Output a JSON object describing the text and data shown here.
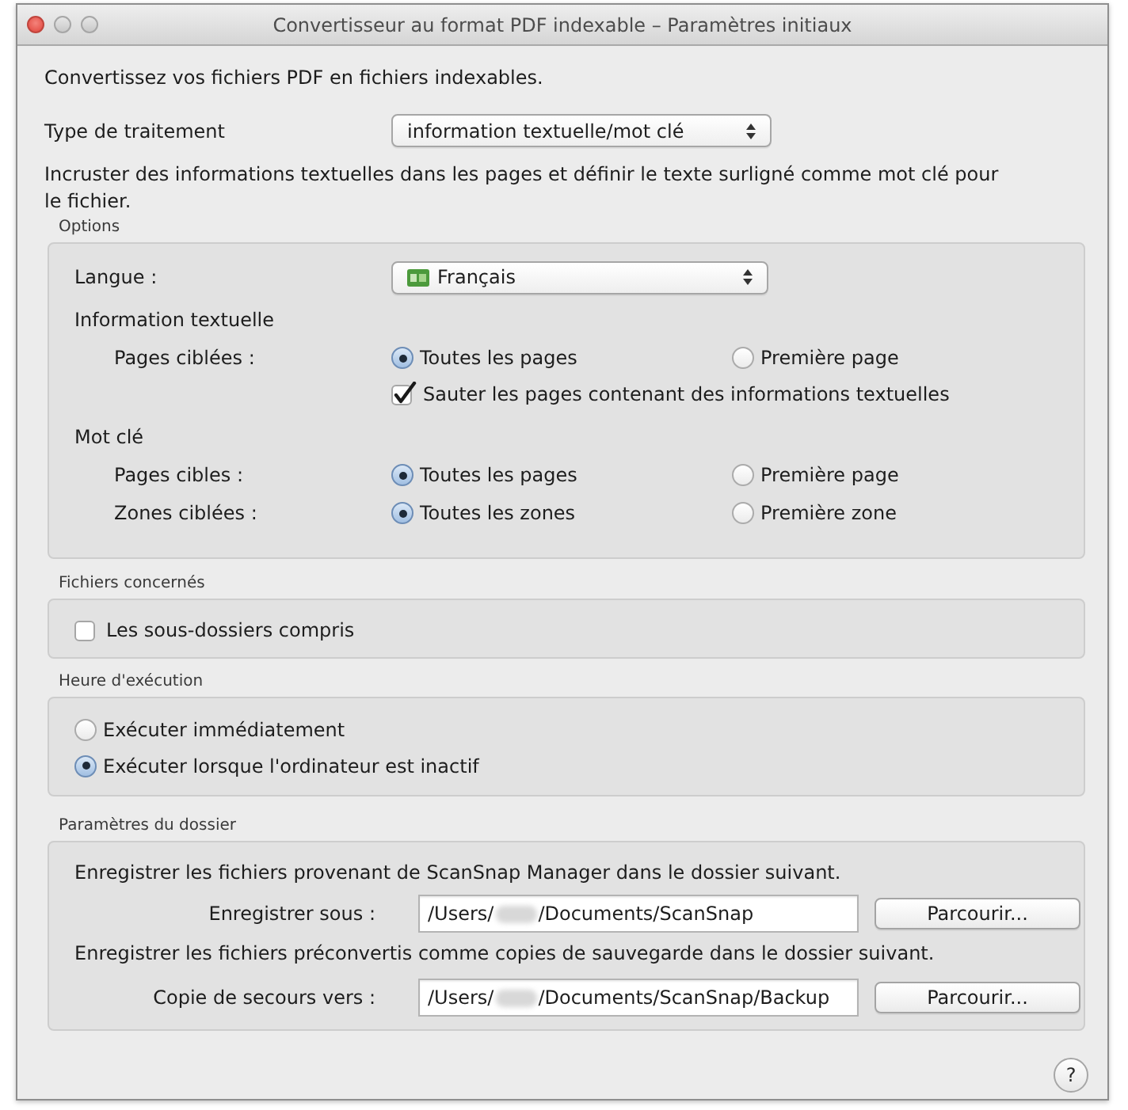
{
  "window": {
    "title": "Convertisseur au format PDF indexable – Paramètres initiaux"
  },
  "intro": "Convertissez vos fichiers PDF en fichiers indexables.",
  "processing_type": {
    "label": "Type de traitement",
    "value": "information textuelle/mot clé"
  },
  "description": "Incruster des informations textuelles dans les pages et définir le texte surligné comme mot clé pour le fichier.",
  "options": {
    "title": "Options",
    "language": {
      "label": "Langue :",
      "value": "Français"
    },
    "sections": [
      {
        "heading": "Information textuelle",
        "items": [
          {
            "kind": "radio",
            "label": "Pages ciblées :",
            "choices": [
              {
                "label": "Toutes les pages",
                "selected": true
              },
              {
                "label": "Première page",
                "selected": false
              }
            ]
          },
          {
            "kind": "checkbox",
            "label": "Sauter les pages contenant des informations textuelles",
            "checked": true
          }
        ]
      },
      {
        "heading": "Mot clé",
        "items": [
          {
            "kind": "radio",
            "label": "Pages cibles :",
            "choices": [
              {
                "label": "Toutes les pages",
                "selected": true
              },
              {
                "label": "Première page",
                "selected": false
              }
            ]
          },
          {
            "kind": "radio",
            "label": "Zones ciblées :",
            "choices": [
              {
                "label": "Toutes les zones",
                "selected": true
              },
              {
                "label": "Première zone",
                "selected": false
              }
            ]
          }
        ]
      }
    ]
  },
  "target_files": {
    "title": "Fichiers concernés",
    "checkbox": {
      "label": "Les sous-dossiers compris",
      "checked": false
    }
  },
  "execution_time": {
    "title": "Heure d'exécution",
    "choices": [
      {
        "label": "Exécuter immédiatement",
        "selected": false
      },
      {
        "label": "Exécuter lorsque l'ordinateur est inactif",
        "selected": true
      }
    ]
  },
  "folder_settings": {
    "title": "Paramètres du dossier",
    "entries": [
      {
        "description": "Enregistrer les fichiers provenant de ScanSnap Manager dans le dossier suivant.",
        "label": "Enregistrer sous :",
        "path_start": "/Users/",
        "path_end": "/Documents/ScanSnap",
        "button": "Parcourir..."
      },
      {
        "description": "Enregistrer les fichiers préconvertis comme copies de sauvegarde dans le dossier suivant.",
        "label": "Copie de secours vers :",
        "path_start": "/Users/",
        "path_end": "/Documents/ScanSnap/Backup",
        "button": "Parcourir..."
      }
    ]
  },
  "help_button": "?"
}
